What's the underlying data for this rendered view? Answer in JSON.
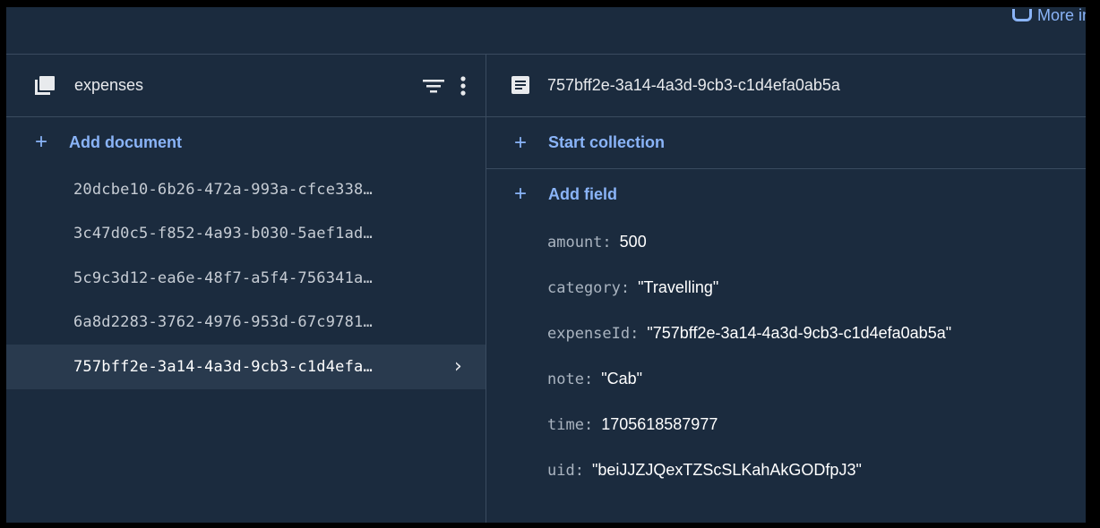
{
  "topbar": {
    "more_label": "More in"
  },
  "collection": {
    "name": "expenses",
    "add_document_label": "Add document",
    "documents": [
      "20dcbe10-6b26-472a-993a-cfce338…",
      "3c47d0c5-f852-4a93-b030-5aef1ad…",
      "5c9c3d12-ea6e-48f7-a5f4-756341a…",
      "6a8d2283-3762-4976-953d-67c9781…",
      "757bff2e-3a14-4a3d-9cb3-c1d4efa…"
    ]
  },
  "document": {
    "id": "757bff2e-3a14-4a3d-9cb3-c1d4efa0ab5a",
    "start_collection_label": "Start collection",
    "add_field_label": "Add field",
    "fields": [
      {
        "key": "amount",
        "value": "500"
      },
      {
        "key": "category",
        "value": "\"Travelling\""
      },
      {
        "key": "expenseId",
        "value": "\"757bff2e-3a14-4a3d-9cb3-c1d4efa0ab5a\""
      },
      {
        "key": "note",
        "value": "\"Cab\""
      },
      {
        "key": "time",
        "value": "1705618587977"
      },
      {
        "key": "uid",
        "value": "\"beiJJZJQexTZScSLKahAkGODfpJ3\""
      }
    ]
  },
  "colors": {
    "background": "#1b2b3e",
    "accent": "#8ab4f8",
    "selected_row": "#293a4e",
    "divider": "#3a4b5f"
  }
}
